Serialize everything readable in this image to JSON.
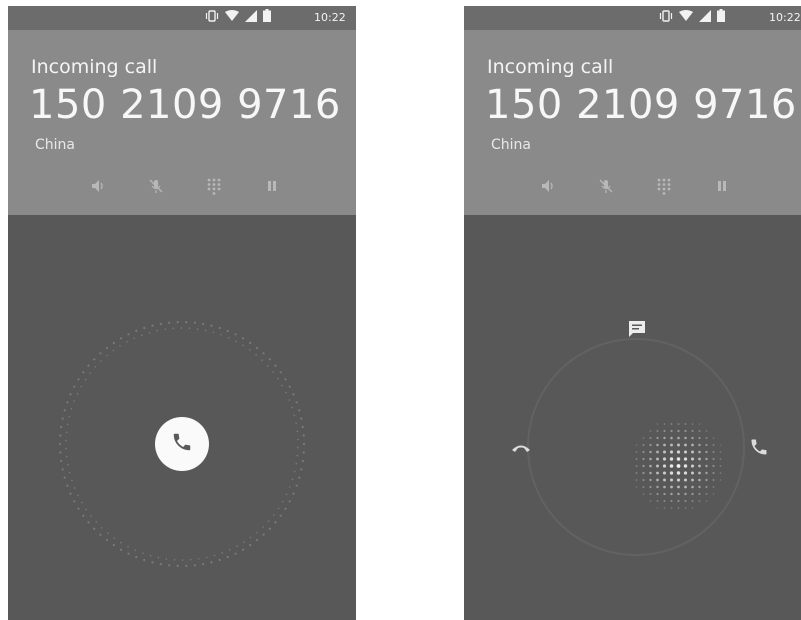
{
  "screens": [
    {
      "status": {
        "time": "10:22",
        "icons": [
          "vibrate-icon",
          "wifi-icon",
          "signal-icon",
          "battery-icon"
        ]
      },
      "call": {
        "title": "Incoming call",
        "number": "150 2109 9716",
        "location": "China"
      },
      "controls": [
        "speaker-icon",
        "mute-icon",
        "dialpad-icon",
        "pause-icon"
      ],
      "state": "idle",
      "center_button": "phone-icon"
    },
    {
      "status": {
        "time": "10:22",
        "icons": [
          "vibrate-icon",
          "wifi-icon",
          "signal-icon",
          "battery-icon"
        ]
      },
      "call": {
        "title": "Incoming call",
        "number": "150 2109 9716",
        "location": "China"
      },
      "controls": [
        "speaker-icon",
        "mute-icon",
        "dialpad-icon",
        "pause-icon"
      ],
      "state": "dragging",
      "targets": [
        "text-reply-icon",
        "decline-icon",
        "answer-icon"
      ]
    }
  ],
  "colors": {
    "page_background": "#ffffff",
    "header_background": "#8a8a8a",
    "status_bar_background": "#6c6c6c",
    "body_background": "#585858",
    "text_primary": "#f7f7f7"
  }
}
